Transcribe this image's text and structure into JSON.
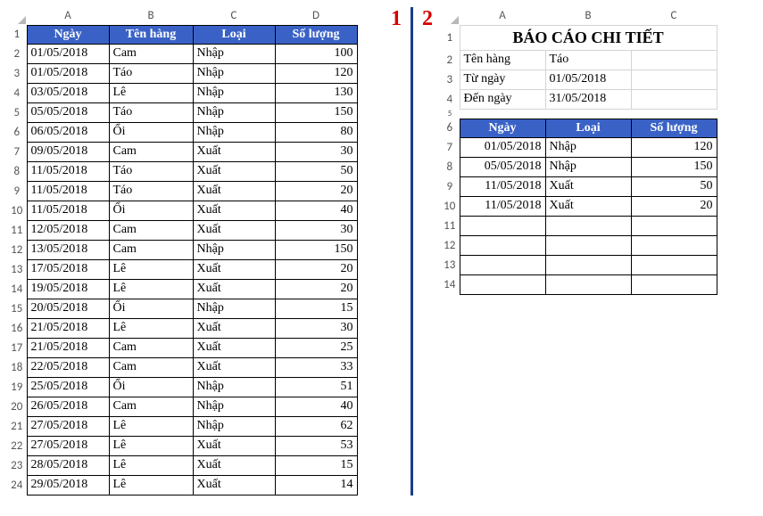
{
  "pane_labels": {
    "one": "1",
    "two": "2"
  },
  "sheet1": {
    "col_letters": [
      "A",
      "B",
      "C",
      "D"
    ],
    "row_nums": [
      "1",
      "2",
      "3",
      "4",
      "5",
      "6",
      "7",
      "8",
      "9",
      "10",
      "11",
      "12",
      "13",
      "14",
      "15",
      "16",
      "17",
      "18",
      "19",
      "20",
      "21",
      "22",
      "23",
      "24"
    ],
    "headers": {
      "ngay": "Ngày",
      "ten_hang": "Tên hàng",
      "loai": "Loại",
      "so_luong": "Số lượng"
    },
    "rows": [
      {
        "ngay": "01/05/2018",
        "ten_hang": "Cam",
        "loai": "Nhập",
        "so_luong": "100"
      },
      {
        "ngay": "01/05/2018",
        "ten_hang": "Táo",
        "loai": "Nhập",
        "so_luong": "120"
      },
      {
        "ngay": "03/05/2018",
        "ten_hang": "Lê",
        "loai": "Nhập",
        "so_luong": "130"
      },
      {
        "ngay": "05/05/2018",
        "ten_hang": "Táo",
        "loai": "Nhập",
        "so_luong": "150"
      },
      {
        "ngay": "06/05/2018",
        "ten_hang": "Ổi",
        "loai": "Nhập",
        "so_luong": "80"
      },
      {
        "ngay": "09/05/2018",
        "ten_hang": "Cam",
        "loai": "Xuất",
        "so_luong": "30"
      },
      {
        "ngay": "11/05/2018",
        "ten_hang": "Táo",
        "loai": "Xuất",
        "so_luong": "50"
      },
      {
        "ngay": "11/05/2018",
        "ten_hang": "Táo",
        "loai": "Xuất",
        "so_luong": "20"
      },
      {
        "ngay": "11/05/2018",
        "ten_hang": "Ổi",
        "loai": "Xuất",
        "so_luong": "40"
      },
      {
        "ngay": "12/05/2018",
        "ten_hang": "Cam",
        "loai": "Xuất",
        "so_luong": "30"
      },
      {
        "ngay": "13/05/2018",
        "ten_hang": "Cam",
        "loai": "Nhập",
        "so_luong": "150"
      },
      {
        "ngay": "17/05/2018",
        "ten_hang": "Lê",
        "loai": "Xuất",
        "so_luong": "20"
      },
      {
        "ngay": "19/05/2018",
        "ten_hang": "Lê",
        "loai": "Xuất",
        "so_luong": "20"
      },
      {
        "ngay": "20/05/2018",
        "ten_hang": "Ổi",
        "loai": "Nhập",
        "so_luong": "15"
      },
      {
        "ngay": "21/05/2018",
        "ten_hang": "Lê",
        "loai": "Xuất",
        "so_luong": "30"
      },
      {
        "ngay": "21/05/2018",
        "ten_hang": "Cam",
        "loai": "Xuất",
        "so_luong": "25"
      },
      {
        "ngay": "22/05/2018",
        "ten_hang": "Cam",
        "loai": "Xuất",
        "so_luong": "33"
      },
      {
        "ngay": "25/05/2018",
        "ten_hang": "Ổi",
        "loai": "Nhập",
        "so_luong": "51"
      },
      {
        "ngay": "26/05/2018",
        "ten_hang": "Cam",
        "loai": "Nhập",
        "so_luong": "40"
      },
      {
        "ngay": "27/05/2018",
        "ten_hang": "Lê",
        "loai": "Nhập",
        "so_luong": "62"
      },
      {
        "ngay": "27/05/2018",
        "ten_hang": "Lê",
        "loai": "Xuất",
        "so_luong": "53"
      },
      {
        "ngay": "28/05/2018",
        "ten_hang": "Lê",
        "loai": "Xuất",
        "so_luong": "15"
      },
      {
        "ngay": "29/05/2018",
        "ten_hang": "Lê",
        "loai": "Xuất",
        "so_luong": "14"
      }
    ]
  },
  "sheet2": {
    "col_letters": [
      "A",
      "B",
      "C"
    ],
    "row_nums": [
      "1",
      "2",
      "3",
      "4",
      "5",
      "6",
      "7",
      "8",
      "9",
      "10",
      "11",
      "12",
      "13",
      "14"
    ],
    "title": "BÁO CÁO CHI TIẾT",
    "filters": {
      "ten_hang_label": "Tên hàng",
      "ten_hang_value": "Táo",
      "tu_ngay_label": "Từ ngày",
      "tu_ngay_value": "01/05/2018",
      "den_ngay_label": "Đến ngày",
      "den_ngay_value": "31/05/2018"
    },
    "headers": {
      "ngay": "Ngày",
      "loai": "Loại",
      "so_luong": "Số lượng"
    },
    "rows": [
      {
        "ngay": "01/05/2018",
        "loai": "Nhập",
        "so_luong": "120"
      },
      {
        "ngay": "05/05/2018",
        "loai": "Nhập",
        "so_luong": "150"
      },
      {
        "ngay": "11/05/2018",
        "loai": "Xuất",
        "so_luong": "50"
      },
      {
        "ngay": "11/05/2018",
        "loai": "Xuất",
        "so_luong": "20"
      }
    ],
    "empty_rows": 4
  }
}
